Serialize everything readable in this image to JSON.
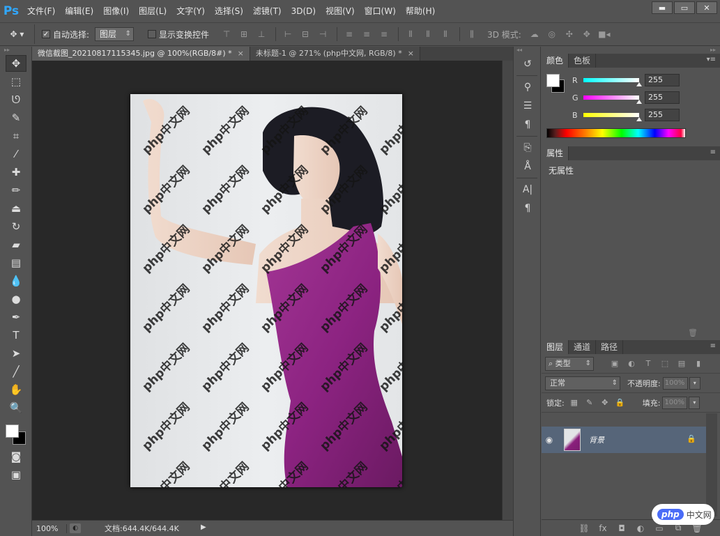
{
  "app": {
    "logo": "Ps",
    "menu": [
      "文件(F)",
      "编辑(E)",
      "图像(I)",
      "图层(L)",
      "文字(Y)",
      "选择(S)",
      "滤镜(T)",
      "3D(D)",
      "视图(V)",
      "窗口(W)",
      "帮助(H)"
    ],
    "window_controls": {
      "minimize": "▬",
      "restore": "▭",
      "close": "✕"
    }
  },
  "options": {
    "auto_select_label": "自动选择:",
    "auto_select_checked": true,
    "auto_select_target": "图层",
    "show_transform_label": "显示变换控件",
    "show_transform_checked": false,
    "mode_3d_label": "3D 模式:"
  },
  "tabs": [
    {
      "label": "微信截图_20210817115345.jpg @ 100%(RGB/8#) *",
      "close": "×",
      "active": true
    },
    {
      "label": "未标题-1 @ 271% (php中文网, RGB/8) *",
      "close": "×",
      "active": false
    }
  ],
  "canvas": {
    "watermark_text": "php中文网"
  },
  "status": {
    "zoom": "100%",
    "doc_info": "文档:644.4K/644.4K"
  },
  "color_panel": {
    "tabs": [
      "颜色",
      "色板"
    ],
    "channels": [
      {
        "label": "R",
        "value": "255",
        "gradient": "linear-gradient(90deg,#00ffff,#ffffff)"
      },
      {
        "label": "G",
        "value": "255",
        "gradient": "linear-gradient(90deg,#ff00ff,#ffffff)"
      },
      {
        "label": "B",
        "value": "255",
        "gradient": "linear-gradient(90deg,#ffff00,#ffffff)"
      }
    ],
    "foreground": "#ffffff",
    "background": "#000000"
  },
  "properties_panel": {
    "tab": "属性",
    "empty_text": "无属性"
  },
  "layers_panel": {
    "tabs": [
      "图层",
      "通道",
      "路径"
    ],
    "kind_filter": "类型",
    "blend_mode": "正常",
    "opacity_label": "不透明度:",
    "opacity_value": "100%",
    "lock_label": "锁定:",
    "fill_label": "填充:",
    "fill_value": "100%",
    "layers": [
      {
        "name": "背景",
        "visible": true,
        "locked": true
      }
    ]
  },
  "badge": {
    "logo": "php",
    "text": "中文网"
  }
}
